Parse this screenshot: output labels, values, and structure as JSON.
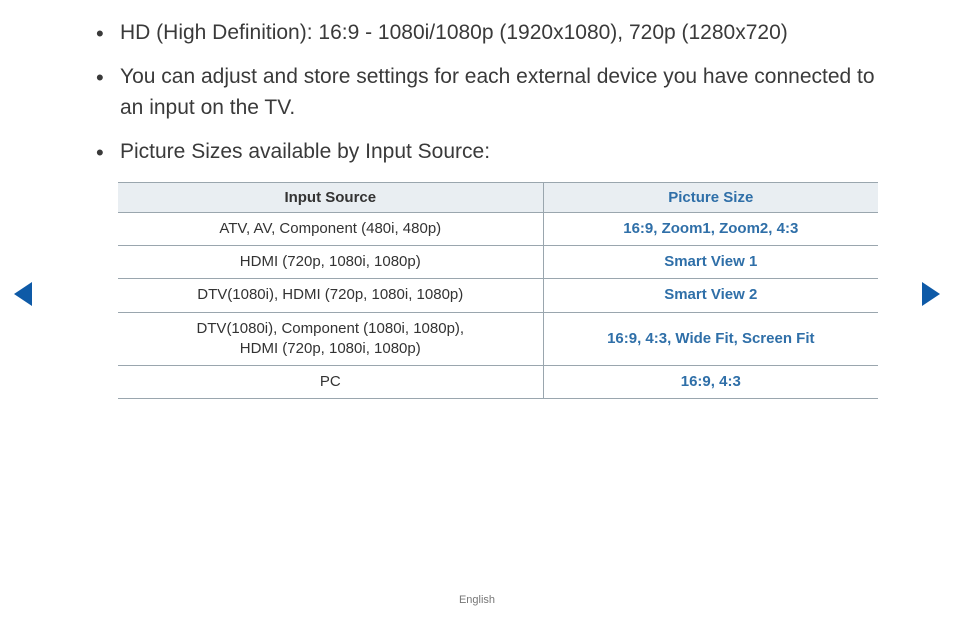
{
  "bullets": {
    "b1": "HD (High Definition): 16:9 - 1080i/1080p (1920x1080), 720p (1280x720)",
    "b2": "You can adjust and store settings for each external device you have connected to an input on the TV.",
    "b3": "Picture Sizes available by Input Source:"
  },
  "table": {
    "headers": {
      "source": "Input Source",
      "size": "Picture Size"
    },
    "rows": [
      {
        "source": "ATV, AV, Component (480i, 480p)",
        "size": "16:9, Zoom1, Zoom2, 4:3"
      },
      {
        "source": "HDMI (720p, 1080i, 1080p)",
        "size": "Smart View 1"
      },
      {
        "source": "DTV(1080i), HDMI (720p, 1080i, 1080p)",
        "size": "Smart View 2"
      },
      {
        "source_line1": "DTV(1080i), Component (1080i, 1080p),",
        "source_line2": "HDMI (720p, 1080i, 1080p)",
        "size": "16:9, 4:3, Wide Fit, Screen Fit"
      },
      {
        "source": "PC",
        "size": "16:9, 4:3"
      }
    ]
  },
  "footer": {
    "language": "English"
  }
}
